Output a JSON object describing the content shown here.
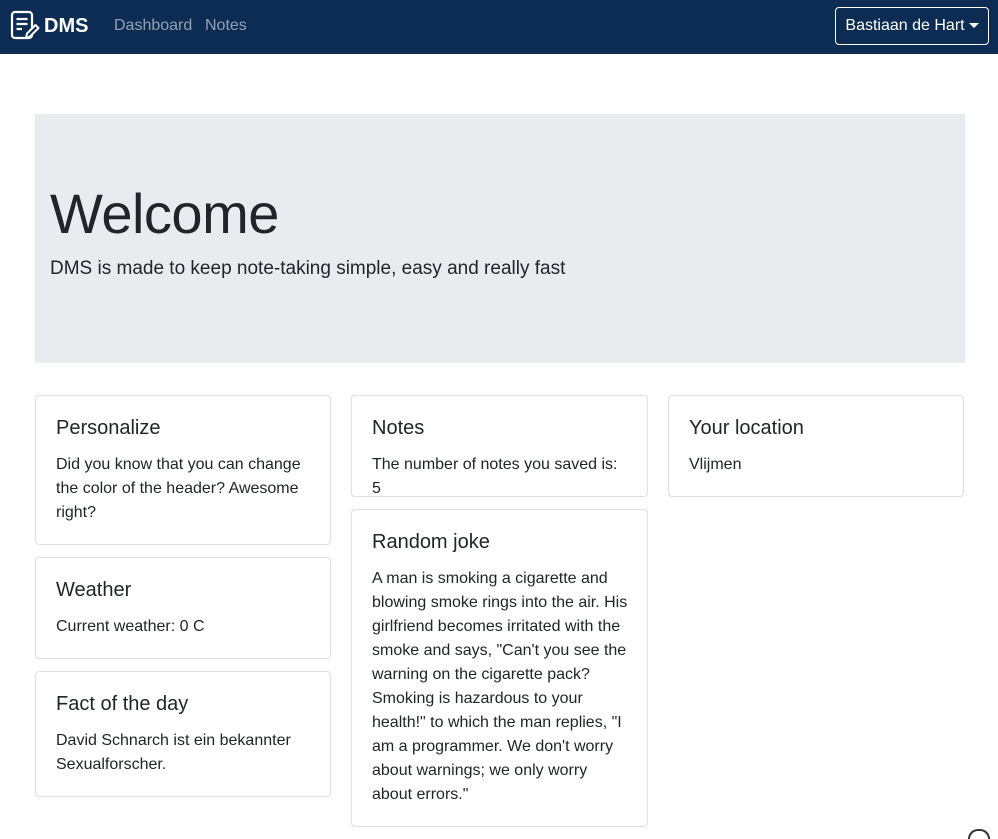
{
  "navbar": {
    "brand": "DMS",
    "brand_icon": "note-edit-icon",
    "links": [
      "Dashboard",
      "Notes"
    ],
    "user_menu": "Bastiaan de Hart",
    "bg_color": "#0d2c54"
  },
  "jumbotron": {
    "title": "Welcome",
    "lead": "DMS is made to keep note-taking simple, easy and really fast"
  },
  "cards": {
    "personalize": {
      "title": "Personalize",
      "text": "Did you know that you can change the color of the header? Awesome right?"
    },
    "weather": {
      "title": "Weather",
      "text": "Current weather: 0 C"
    },
    "fact": {
      "title": "Fact of the day",
      "text": "David Schnarch ist ein bekannter Sexualforscher."
    },
    "notes": {
      "title": "Notes",
      "text": "The number of notes you saved is: 5"
    },
    "joke": {
      "title": "Random joke",
      "text": "A man is smoking a cigarette and blowing smoke rings into the air. His girlfriend becomes irritated with the smoke and says, \"Can't you see the warning on the cigarette pack? Smoking is hazardous to your health!\" to which the man replies, \"I am a programmer. We don't worry about warnings; we only worry about errors.\""
    },
    "location": {
      "title": "Your location",
      "text": "Vlijmen"
    }
  }
}
